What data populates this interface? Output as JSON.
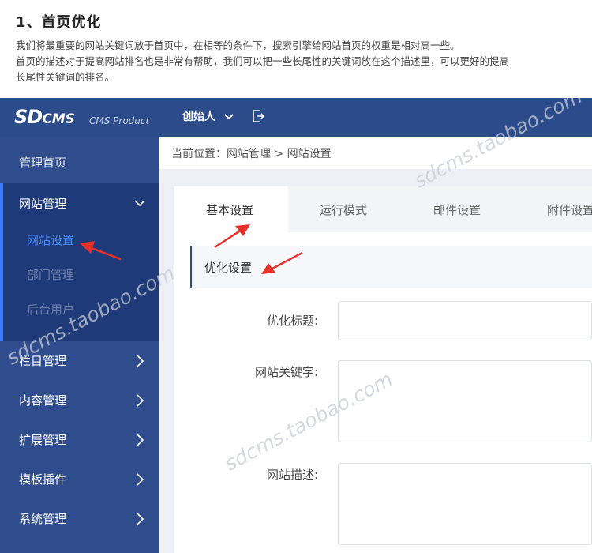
{
  "article": {
    "title": "1、首页优化",
    "lines": [
      "我们将最重要的网站关键词放于首页中，在相等的条件下，搜索引擎给网站首页的权重是相对高一些。",
      "首页的描述对于提高网站排名也是非常有帮助，我们可以把一些长尾性的关键词放在这个描述里，可以更好的提高",
      "长尾性关键词的排名。"
    ]
  },
  "app": {
    "logo": {
      "sd": "SD",
      "cms": "CMS",
      "subtitle": "CMS Product"
    },
    "user": "创始人",
    "breadcrumb": "当前位置：网站管理 > 网站设置",
    "sidebar": {
      "home": "管理首页",
      "site": "网站管理",
      "sub": [
        "网站设置",
        "部门管理",
        "后台用户"
      ],
      "items": [
        "栏目管理",
        "内容管理",
        "扩展管理",
        "模板插件",
        "系统管理"
      ]
    },
    "tabs": [
      "基本设置",
      "运行模式",
      "邮件设置",
      "附件设置"
    ],
    "section": "优化设置",
    "form": {
      "title_label": "优化标题:",
      "keywords_label": "网站关键字:",
      "desc_label": "网站描述:"
    },
    "watermark": "sdcms.taobao.com",
    "colors": {
      "topbar": "#2c4b8a",
      "sidebar": "#2f4d8c",
      "sidebar_active_group": "#1f3a78",
      "active_sub": "#4d8dff",
      "annotation": "#e8302b"
    }
  }
}
